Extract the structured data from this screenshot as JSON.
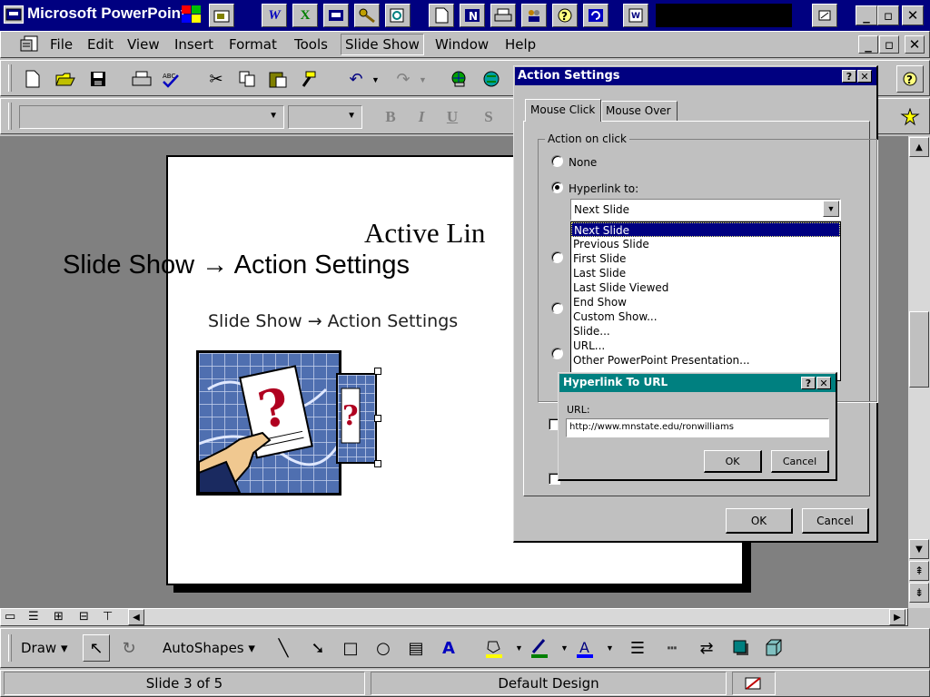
{
  "window": {
    "app_title": "Microsoft PowerPoint"
  },
  "menu": {
    "items": [
      "File",
      "Edit",
      "View",
      "Insert",
      "Format",
      "Tools",
      "Slide Show",
      "Window",
      "Help"
    ]
  },
  "formatting": {
    "bold": "B",
    "italic": "I",
    "underline": "U",
    "shadow": "S"
  },
  "slide": {
    "title": "Active Lin",
    "overlay_text": "Slide Show → Action Settings",
    "body_text": "Slide Show → Action Settings"
  },
  "action_settings": {
    "title": "Action Settings",
    "help": "?",
    "close": "✕",
    "tabs": [
      "Mouse Click",
      "Mouse Over"
    ],
    "group_label": "Action on click",
    "radio_none": "None",
    "radio_hyperlink": "Hyperlink to:",
    "dropdown_value": "Next Slide",
    "list_options": [
      "Next Slide",
      "Previous Slide",
      "First Slide",
      "Last Slide",
      "Last Slide Viewed",
      "End Show",
      "Custom Show...",
      "Slide...",
      "URL...",
      "Other PowerPoint Presentation..."
    ],
    "ok_label": "OK",
    "cancel_label": "Cancel"
  },
  "hyperlink_url": {
    "title": "Hyperlink To URL",
    "help": "?",
    "close": "✕",
    "url_label": "URL:",
    "url_value": "http://www.mnstate.edu/ronwilliams",
    "ok_label": "OK",
    "cancel_label": "Cancel"
  },
  "drawing": {
    "draw_label": "Draw",
    "autoshapes_label": "AutoShapes"
  },
  "status": {
    "slide_info": "Slide 3 of 5",
    "design": "Default Design"
  },
  "colors": {
    "title_bar": "#000080",
    "workspace": "#808080",
    "face": "#c0c0c0"
  }
}
